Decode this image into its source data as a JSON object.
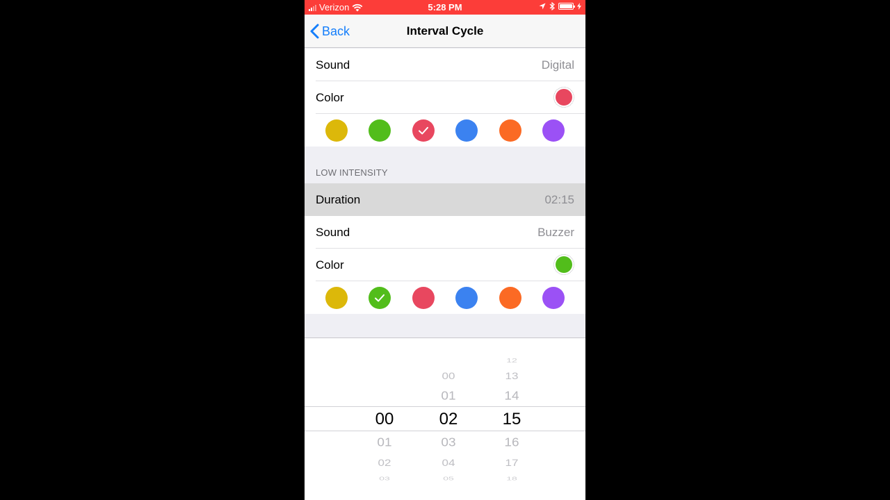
{
  "status_bar": {
    "carrier": "Verizon",
    "time": "5:28 PM",
    "background_color": "#fc3d39"
  },
  "nav": {
    "back_label": "Back",
    "title": "Interval Cycle",
    "accent_color": "#147efb"
  },
  "high_intensity": {
    "sound_label": "Sound",
    "sound_value": "Digital",
    "color_label": "Color",
    "selected_color": "#e8475f",
    "selected_index": 2
  },
  "low_intensity": {
    "header": "LOW INTENSITY",
    "duration_label": "Duration",
    "duration_value": "02:15",
    "sound_label": "Sound",
    "sound_value": "Buzzer",
    "color_label": "Color",
    "selected_color": "#52bd1b",
    "selected_index": 1
  },
  "palette": [
    "#dcb80a",
    "#52bd1b",
    "#e8475f",
    "#3b82f0",
    "#fb6a24",
    "#9b51f5"
  ],
  "picker": {
    "hours": {
      "above": [],
      "selected": "00",
      "below": [
        "01",
        "02",
        "03"
      ]
    },
    "minutes": {
      "above": [
        "00",
        "01"
      ],
      "selected": "02",
      "below": [
        "03",
        "04",
        "05"
      ]
    },
    "seconds": {
      "above": [
        "12",
        "13",
        "14"
      ],
      "selected": "15",
      "below": [
        "16",
        "17",
        "18"
      ]
    }
  }
}
